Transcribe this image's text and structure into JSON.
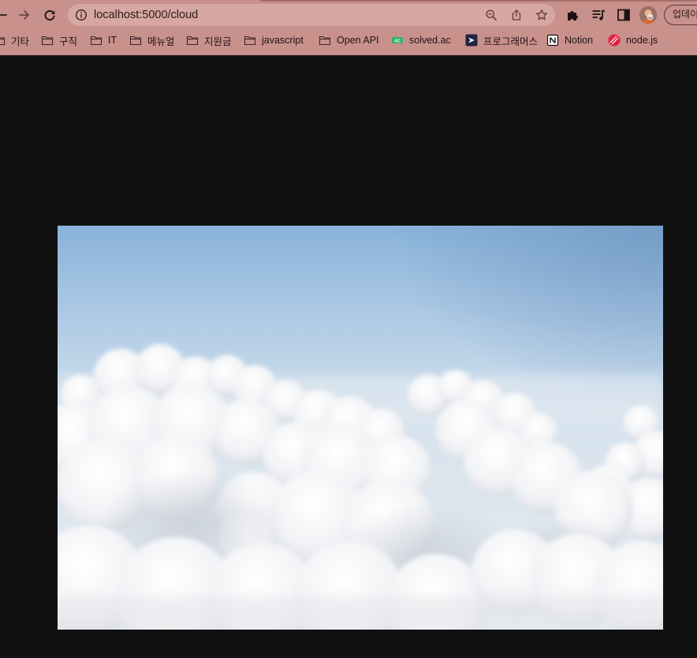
{
  "browser": {
    "url": "localhost:5000/cloud",
    "update_button_label": "업데이",
    "nav_icons": [
      "back-arrow-icon",
      "forward-arrow-icon",
      "reload-icon"
    ],
    "omnibox_icons": [
      "info-icon",
      "zoom-icon",
      "share-icon",
      "star-icon"
    ],
    "toolbar_icons": [
      "extensions-puzzle-icon",
      "media-queue-icon",
      "side-panel-icon",
      "profile-avatar"
    ],
    "bookmarks": [
      {
        "label": "기타",
        "icon": "folder-icon"
      },
      {
        "label": "구직",
        "icon": "folder-icon"
      },
      {
        "label": "IT",
        "icon": "folder-icon"
      },
      {
        "label": "메뉴얼",
        "icon": "folder-icon"
      },
      {
        "label": "지원금",
        "icon": "folder-icon"
      },
      {
        "label": "javascript",
        "icon": "folder-icon"
      },
      {
        "label": "Open API",
        "icon": "folder-icon"
      },
      {
        "label": "solved.ac",
        "icon": "solved-ac-icon"
      },
      {
        "label": "프로그래머스",
        "icon": "programmers-icon"
      },
      {
        "label": "Notion",
        "icon": "notion-icon"
      },
      {
        "label": "node.js",
        "icon": "nodejs-icon"
      }
    ]
  },
  "colors": {
    "chrome_background": "#c9918c",
    "omnibox_background": "#d7a7a2",
    "page_background": "#111111"
  },
  "page": {
    "image": {
      "subject": "clouds-photo"
    }
  }
}
